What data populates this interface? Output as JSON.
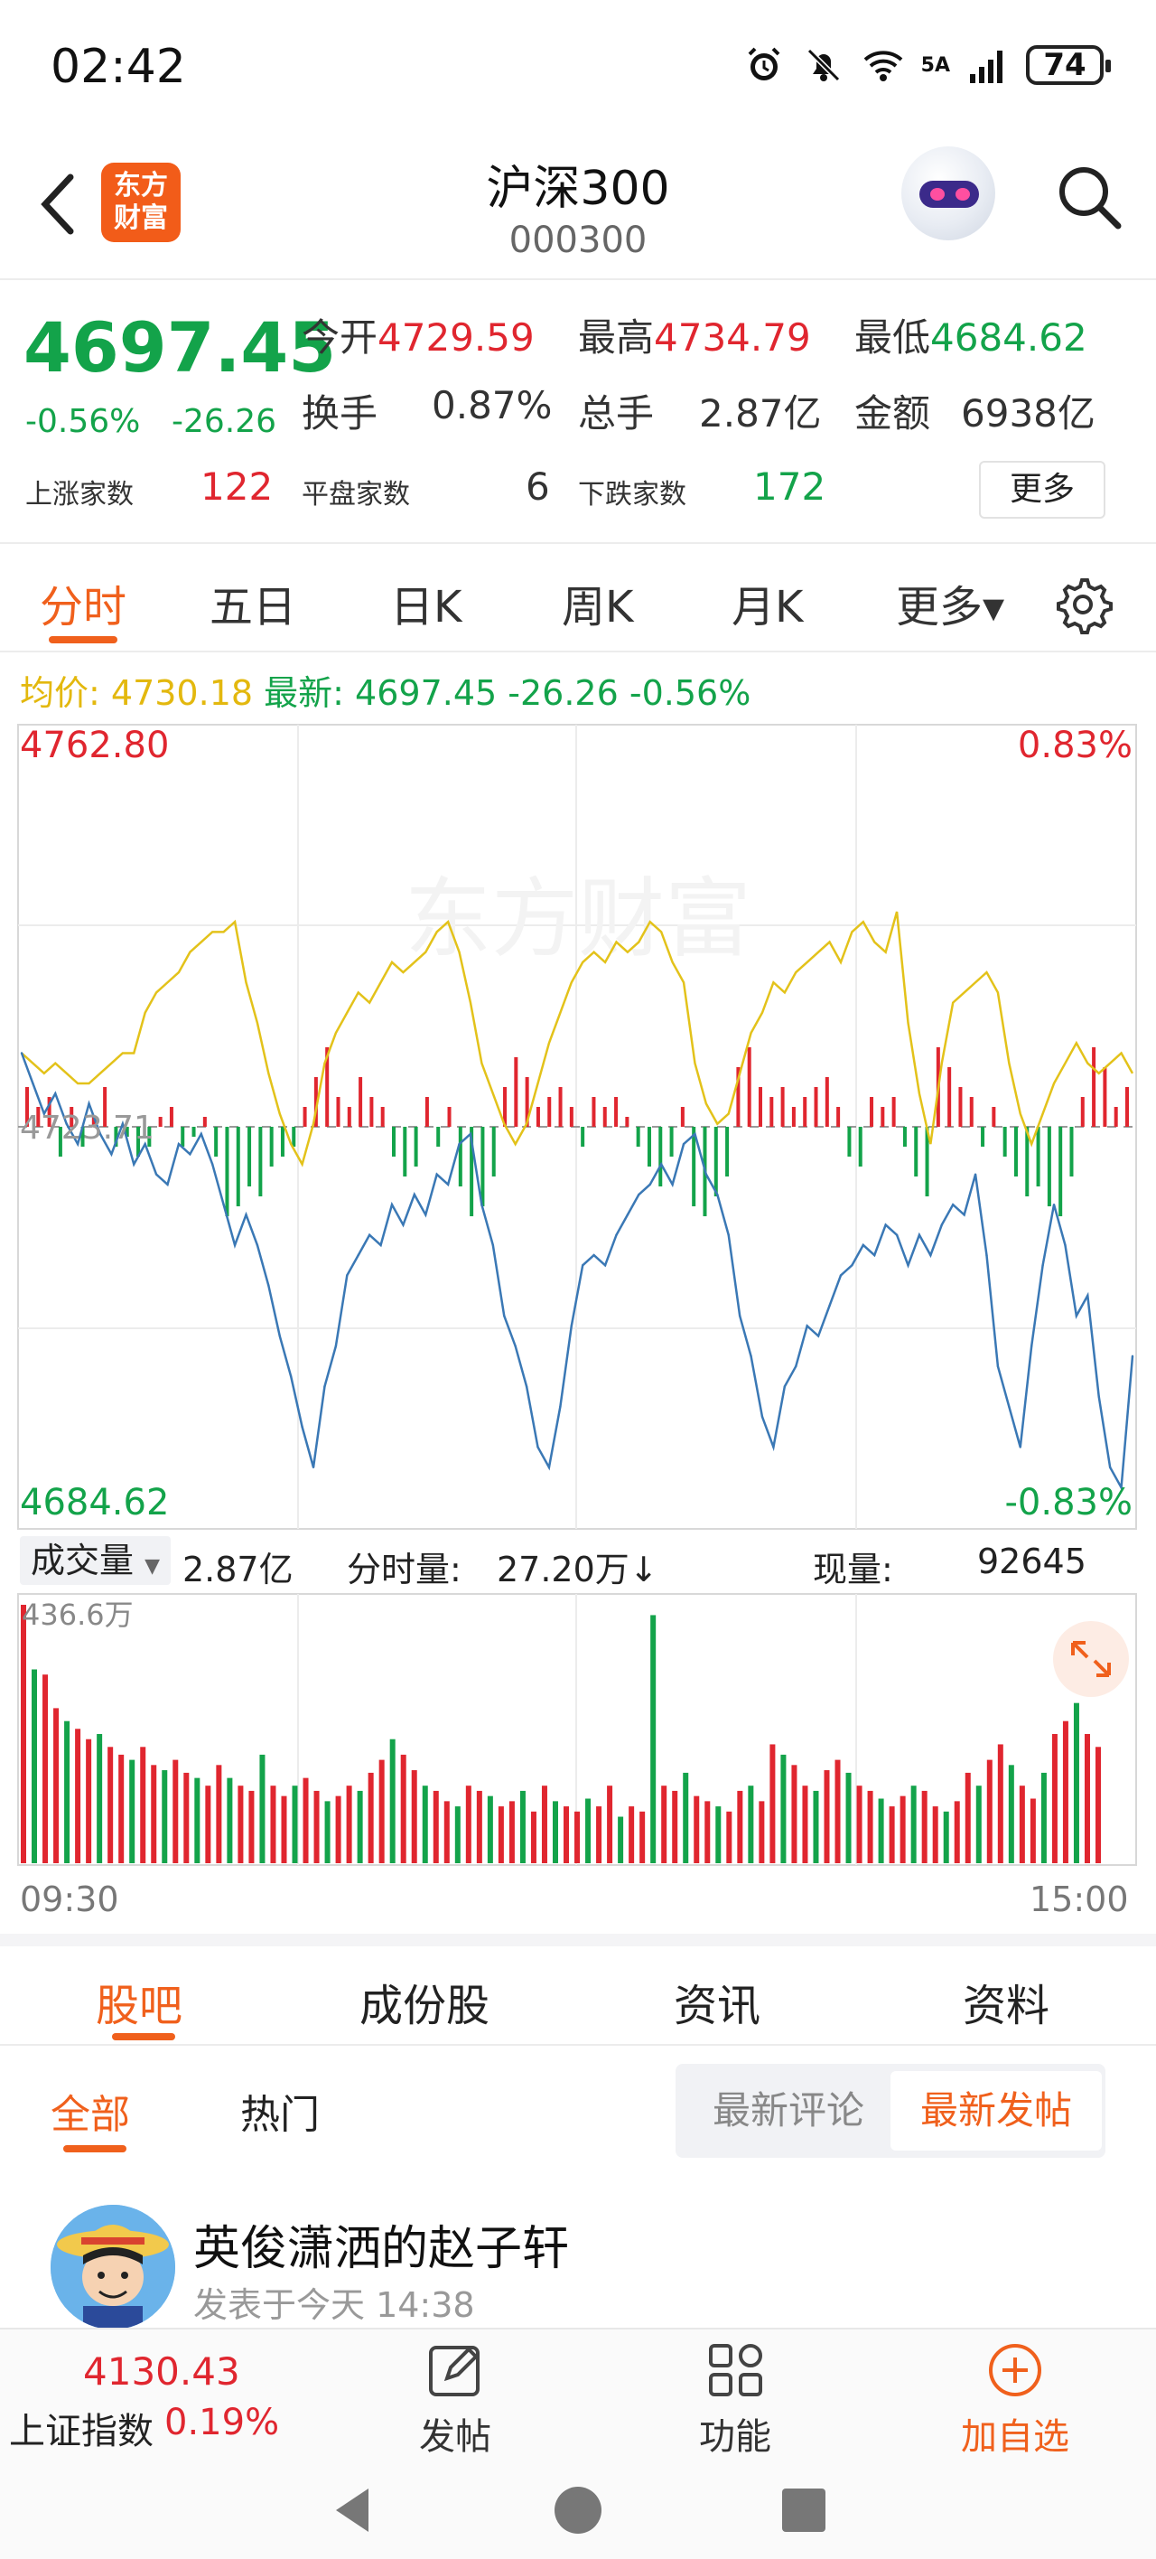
{
  "status_bar": {
    "time": "02:42",
    "network_label": "5A",
    "battery": "74",
    "icons": [
      "alarm-icon",
      "mute-icon",
      "wifi-icon",
      "signal-icon",
      "battery-icon"
    ]
  },
  "navbar": {
    "logo_line1": "东方",
    "logo_line2": "财富",
    "title": "沪深300",
    "code": "000300"
  },
  "quote": {
    "price": "4697.45",
    "change_pct": "-0.56%",
    "change_abs": "-26.26",
    "open_label": "今开",
    "open": "4729.59",
    "high_label": "最高",
    "high": "4734.79",
    "low_label": "最低",
    "low": "4684.62",
    "turnover_label": "换手",
    "turnover": "0.87%",
    "volume_label": "总手",
    "volume": "2.87亿",
    "amount_label": "金额",
    "amount": "6938亿",
    "up_label": "上涨家数",
    "up": "122",
    "flat_label": "平盘家数",
    "flat": "6",
    "down_label": "下跌家数",
    "down": "172",
    "more": "更多"
  },
  "tabs": [
    "分时",
    "五日",
    "日K",
    "周K",
    "月K",
    "更多▾"
  ],
  "active_tab": "分时",
  "info_line": {
    "avg_label": "均价:",
    "avg": "4730.18",
    "latest_label": "最新:",
    "latest": "4697.45",
    "latest_chg": "-26.26",
    "latest_pct": "-0.56%"
  },
  "colors": {
    "up": "#e0262f",
    "down": "#13a34a",
    "accent": "#f0601c",
    "avg_line": "#e3c21a",
    "price_line": "#3a78b5"
  },
  "chart_data": {
    "type": "line",
    "y_max_label": "4762.80",
    "y_min_label": "4684.62",
    "pct_max_label": "0.83%",
    "pct_min_label": "-0.83%",
    "prev_close_label": "4723.71",
    "ylim": [
      4684.62,
      4762.8
    ],
    "x_range": [
      "09:30",
      "15:00"
    ],
    "watermark": "东方财富",
    "series": [
      {
        "values": [
          4731,
          4728,
          4725,
          4727,
          4724,
          4722,
          4726,
          4723,
          4721,
          4724,
          4720,
          4722,
          4719,
          4718,
          4722,
          4721,
          4723,
          4720,
          4716,
          4712,
          4715,
          4712,
          4708,
          4703,
          4699,
          4694,
          4690,
          4698,
          4702,
          4709,
          4711,
          4713,
          4712,
          4716,
          4714,
          4717,
          4715,
          4719,
          4718,
          4722,
          4723,
          4716,
          4712,
          4705,
          4702,
          4698,
          4692,
          4690,
          4696,
          4704,
          4710,
          4711,
          4710,
          4713,
          4715,
          4717,
          4718,
          4720,
          4718,
          4722,
          4723,
          4719,
          4717,
          4713,
          4705,
          4701,
          4695,
          4692,
          4698,
          4700,
          4704,
          4703,
          4706,
          4709,
          4710,
          4712,
          4711,
          4714,
          4713,
          4710,
          4713,
          4711,
          4714,
          4716,
          4715,
          4719,
          4711,
          4700,
          4696,
          4692,
          4702,
          4710,
          4716,
          4712,
          4705,
          4707,
          4697,
          4690,
          4688,
          4701
        ]
      },
      {
        "values": [
          4731,
          4730,
          4729,
          4730,
          4729,
          4728,
          4728,
          4729,
          4730,
          4731,
          4731,
          4735,
          4737,
          4738,
          4739,
          4741,
          4742,
          4743,
          4743,
          4744,
          4738,
          4734,
          4729,
          4725,
          4722,
          4720,
          4724,
          4730,
          4733,
          4735,
          4737,
          4736,
          4738,
          4740,
          4739,
          4740,
          4741,
          4743,
          4744,
          4741,
          4736,
          4730,
          4727,
          4724,
          4722,
          4724,
          4728,
          4732,
          4735,
          4738,
          4740,
          4741,
          4740,
          4742,
          4741,
          4742,
          4744,
          4743,
          4740,
          4738,
          4730,
          4726,
          4724,
          4725,
          4729,
          4733,
          4735,
          4738,
          4737,
          4739,
          4740,
          4741,
          4742,
          4740,
          4743,
          4744,
          4742,
          4741,
          4745,
          4734,
          4727,
          4722,
          4730,
          4736,
          4737,
          4738,
          4739,
          4737,
          4730,
          4725,
          4722,
          4725,
          4728,
          4730,
          4732,
          4730,
          4729,
          4730,
          4731,
          4729
        ]
      }
    ],
    "net_flow_bars": [
      0.4,
      0.2,
      0.3,
      -0.3,
      0.2,
      -0.2,
      0.1,
      0.4,
      -0.2,
      -0.1,
      -0.3,
      -0.2,
      0.1,
      0.2,
      -0.2,
      -0.1,
      0.1,
      -0.3,
      -0.9,
      -0.8,
      -0.6,
      -0.7,
      -0.4,
      -0.3,
      -0.2,
      0.2,
      0.5,
      0.8,
      0.3,
      0.2,
      0.5,
      0.3,
      0.2,
      -0.3,
      -0.5,
      -0.4,
      0.3,
      -0.2,
      0.2,
      -0.6,
      -0.9,
      -0.8,
      -0.5,
      0.4,
      0.7,
      0.5,
      0.2,
      0.3,
      0.4,
      0.2,
      -0.2,
      0.3,
      0.2,
      0.3,
      0.1,
      -0.2,
      -0.4,
      -0.6,
      -0.3,
      0.2,
      -0.8,
      -0.9,
      -0.7,
      -0.5,
      0.6,
      0.8,
      0.4,
      0.3,
      0.4,
      0.2,
      0.3,
      0.4,
      0.5,
      0.2,
      -0.3,
      -0.4,
      0.3,
      0.2,
      0.3,
      -0.2,
      -0.5,
      -0.7,
      0.8,
      0.6,
      0.4,
      0.3,
      -0.2,
      0.2,
      -0.3,
      -0.5,
      -0.7,
      -0.6,
      -0.8,
      -0.9,
      -0.5,
      0.3,
      0.8,
      0.6,
      0.2,
      0.4
    ]
  },
  "volume": {
    "chip": "成交量",
    "total": "2.87亿",
    "minute_label": "分时量:",
    "minute": "27.20万↓",
    "current_label": "现量:",
    "current": "92645",
    "max_label": "436.6万",
    "bars": [
      1.0,
      0.75,
      0.73,
      0.6,
      0.55,
      0.52,
      0.48,
      0.5,
      0.45,
      0.42,
      0.4,
      0.45,
      0.38,
      0.36,
      0.4,
      0.35,
      0.33,
      0.3,
      0.38,
      0.33,
      0.3,
      0.28,
      0.42,
      0.3,
      0.26,
      0.3,
      0.33,
      0.28,
      0.24,
      0.26,
      0.3,
      0.28,
      0.35,
      0.4,
      0.48,
      0.42,
      0.36,
      0.3,
      0.28,
      0.24,
      0.22,
      0.3,
      0.28,
      0.26,
      0.22,
      0.24,
      0.28,
      0.2,
      0.3,
      0.24,
      0.22,
      0.2,
      0.25,
      0.22,
      0.3,
      0.18,
      0.22,
      0.2,
      0.96,
      0.3,
      0.28,
      0.35,
      0.26,
      0.24,
      0.22,
      0.2,
      0.28,
      0.3,
      0.24,
      0.46,
      0.42,
      0.38,
      0.3,
      0.28,
      0.36,
      0.4,
      0.35,
      0.3,
      0.28,
      0.25,
      0.22,
      0.26,
      0.3,
      0.28,
      0.22,
      0.2,
      0.24,
      0.35,
      0.3,
      0.4,
      0.46,
      0.38,
      0.3,
      0.25,
      0.35,
      0.5,
      0.55,
      0.62,
      0.5,
      0.45
    ]
  },
  "time_axis": {
    "start": "09:30",
    "end": "15:00"
  },
  "section_tabs": [
    "股吧",
    "成份股",
    "资讯",
    "资料"
  ],
  "sub_tabs": {
    "all": "全部",
    "hot": "热门",
    "latest_comment": "最新评论",
    "latest_post": "最新发帖"
  },
  "post": {
    "author": "英俊潇洒的赵子轩",
    "meta": "发表于今天 14:38"
  },
  "bottom": {
    "index_value": "4130.43",
    "index_name": "上证指数",
    "index_pct": "0.19%",
    "post": "发帖",
    "features": "功能",
    "add_watch": "加自选"
  }
}
